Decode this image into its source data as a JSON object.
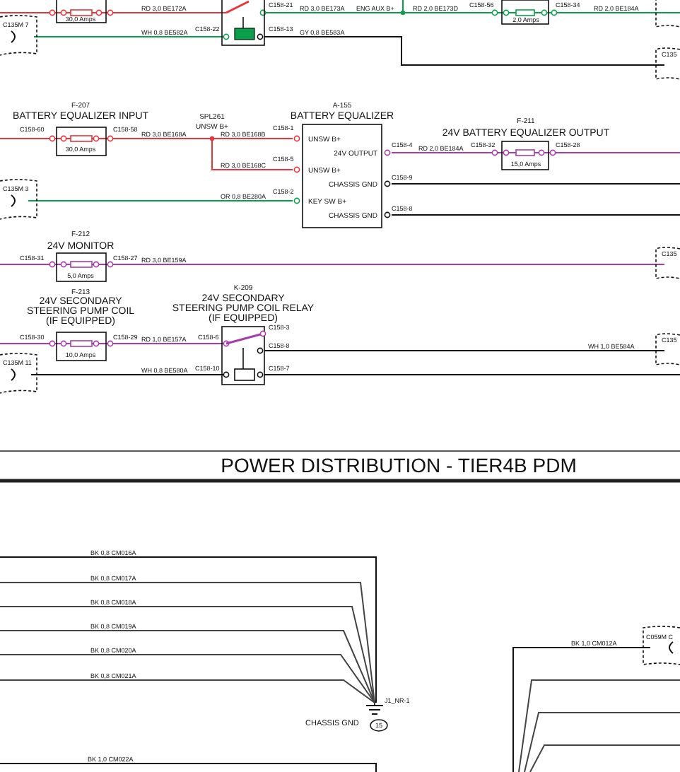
{
  "labels": [
    {
      "text": "30,0 Amps",
      "kind": "rating"
    },
    {
      "text": "RD 3,0 BE172A",
      "kind": "wire"
    },
    {
      "text": "C158-21",
      "kind": "pin"
    },
    {
      "text": "RD 3,0 BE173A",
      "kind": "wire"
    },
    {
      "text": "ENG AUX B+",
      "kind": "wire"
    },
    {
      "text": "RD 2,0 BE173D",
      "kind": "wire"
    },
    {
      "text": "C158-56",
      "kind": "pin"
    },
    {
      "text": "2,0 Amps",
      "kind": "rating"
    },
    {
      "text": "C158-34",
      "kind": "pin"
    },
    {
      "text": "RD 2,0 BE184A",
      "kind": "wire"
    },
    {
      "text": "C135",
      "kind": "connector"
    },
    {
      "text": "C135M 7",
      "kind": "connector"
    },
    {
      "text": "WH 0,8 BE582A",
      "kind": "wire"
    },
    {
      "text": "C158-22",
      "kind": "pin"
    },
    {
      "text": "C158-13",
      "kind": "pin"
    },
    {
      "text": "GY 0,8 BE583A",
      "kind": "wire"
    },
    {
      "text": "F-207",
      "kind": "id"
    },
    {
      "text": "BATTERY EQUALIZER INPUT",
      "kind": "comp"
    },
    {
      "text": "C158-60",
      "kind": "pin"
    },
    {
      "text": "30,0 Amps",
      "kind": "rating"
    },
    {
      "text": "C158-58",
      "kind": "pin"
    },
    {
      "text": "RD 3,0 BE168A",
      "kind": "wire"
    },
    {
      "text": "SPL261",
      "kind": "id"
    },
    {
      "text": "UNSW B+",
      "kind": "id"
    },
    {
      "text": "RD 3,0 BE168B",
      "kind": "wire"
    },
    {
      "text": "C158-1",
      "kind": "pin"
    },
    {
      "text": "A-155",
      "kind": "id"
    },
    {
      "text": "BATTERY EQUALIZER",
      "kind": "comp"
    },
    {
      "text": "UNSW B+",
      "kind": "port"
    },
    {
      "text": "24V OUTPUT",
      "kind": "port"
    },
    {
      "text": "UNSW B+",
      "kind": "port"
    },
    {
      "text": "CHASSIS GND",
      "kind": "port"
    },
    {
      "text": "KEY SW B+",
      "kind": "port"
    },
    {
      "text": "CHASSIS GND",
      "kind": "port"
    },
    {
      "text": "C158-5",
      "kind": "pin"
    },
    {
      "text": "RD 3,0 BE168C",
      "kind": "wire"
    },
    {
      "text": "C158-4",
      "kind": "pin"
    },
    {
      "text": "RD 2,0 BE184A",
      "kind": "wire"
    },
    {
      "text": "F-211",
      "kind": "id"
    },
    {
      "text": "24V BATTERY EQUALIZER OUTPUT",
      "kind": "comp"
    },
    {
      "text": "C158-32",
      "kind": "pin"
    },
    {
      "text": "15,0 Amps",
      "kind": "rating"
    },
    {
      "text": "C158-28",
      "kind": "pin"
    },
    {
      "text": "C158-9",
      "kind": "pin"
    },
    {
      "text": "C158-8",
      "kind": "pin"
    },
    {
      "text": "C135M 3",
      "kind": "connector"
    },
    {
      "text": "OR 0,8 BE280A",
      "kind": "wire"
    },
    {
      "text": "C158-2",
      "kind": "pin"
    },
    {
      "text": "F-212",
      "kind": "id"
    },
    {
      "text": "24V MONITOR",
      "kind": "comp"
    },
    {
      "text": "C158-31",
      "kind": "pin"
    },
    {
      "text": "5,0 Amps",
      "kind": "rating"
    },
    {
      "text": "C158-27",
      "kind": "pin"
    },
    {
      "text": "RD 3,0 BE159A",
      "kind": "wire"
    },
    {
      "text": "C135",
      "kind": "connector"
    },
    {
      "text": "F-213",
      "kind": "id"
    },
    {
      "text": "24V SECONDARY",
      "kind": "comp"
    },
    {
      "text": "STEERING PUMP COIL",
      "kind": "comp"
    },
    {
      "text": "(IF EQUIPPED)",
      "kind": "comp"
    },
    {
      "text": "K-209",
      "kind": "id"
    },
    {
      "text": "24V SECONDARY",
      "kind": "comp"
    },
    {
      "text": "STEERING PUMP COIL RELAY",
      "kind": "comp"
    },
    {
      "text": "(IF EQUIPPED)",
      "kind": "comp"
    },
    {
      "text": "C158-30",
      "kind": "pin"
    },
    {
      "text": "10,0 Amps",
      "kind": "rating"
    },
    {
      "text": "C158-29",
      "kind": "pin"
    },
    {
      "text": "RD 1,0 BE157A",
      "kind": "wire"
    },
    {
      "text": "C158-6",
      "kind": "pin"
    },
    {
      "text": "C158-3",
      "kind": "pin"
    },
    {
      "text": "C158-8",
      "kind": "pin"
    },
    {
      "text": "WH 1,0 BE584A",
      "kind": "wire"
    },
    {
      "text": "C135",
      "kind": "connector"
    },
    {
      "text": "C135M 11",
      "kind": "connector"
    },
    {
      "text": "WH 0,8 BE580A",
      "kind": "wire"
    },
    {
      "text": "C158-10",
      "kind": "pin"
    },
    {
      "text": "C158-7",
      "kind": "pin"
    },
    {
      "text": "POWER DISTRIBUTION - TIER4B PDM",
      "kind": "title"
    },
    {
      "text": "BK 0,8 CM016A",
      "kind": "wire"
    },
    {
      "text": "BK 0,8 CM017A",
      "kind": "wire"
    },
    {
      "text": "BK 0,8 CM018A",
      "kind": "wire"
    },
    {
      "text": "BK 0,8 CM019A",
      "kind": "wire"
    },
    {
      "text": "BK 0,8 CM020A",
      "kind": "wire"
    },
    {
      "text": "BK 0,8 CM021A",
      "kind": "wire"
    },
    {
      "text": "J1_NR-1",
      "kind": "pin"
    },
    {
      "text": "CHASSIS GND",
      "kind": "gnd"
    },
    {
      "text": "15",
      "kind": "callout"
    },
    {
      "text": "BK 1,0 CM012A",
      "kind": "wire"
    },
    {
      "text": "C059M C",
      "kind": "connector"
    },
    {
      "text": "BK 1,0 CM022A",
      "kind": "wire"
    }
  ]
}
